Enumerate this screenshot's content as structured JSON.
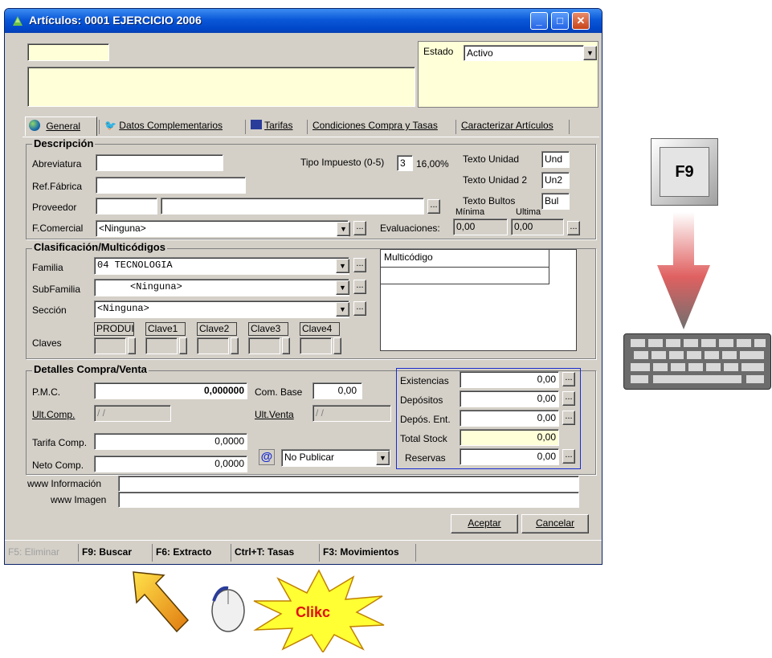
{
  "window": {
    "title": "Artículos: 0001 EJERCICIO 2006",
    "title_icon": "tree-icon",
    "controls": {
      "minimize": "_",
      "maximize": "□",
      "close": "✕"
    }
  },
  "header": {
    "code_value": "",
    "description_value": "",
    "estado_label": "Estado",
    "estado_value": "Activo"
  },
  "tabs": [
    {
      "label": "General",
      "icon": "globe-icon"
    },
    {
      "label": "Datos Complementarios",
      "icon": "bird-icon"
    },
    {
      "label": "Tarifas",
      "icon": "tag-icon"
    },
    {
      "label": "Condiciones Compra y Tasas"
    },
    {
      "label": "Caracterizar Artículos"
    }
  ],
  "descripcion": {
    "title": "Descripción",
    "abreviatura_label": "Abreviatura",
    "ref_fabrica_label": "Ref.Fábrica",
    "proveedor_label": "Proveedor",
    "fcomercial_label": "F.Comercial",
    "fcomercial_value": "<Ninguna>",
    "tipo_impuesto_label": "Tipo Impuesto (0-5)",
    "tipo_impuesto_value": "3",
    "tipo_impuesto_pct": "16,00%",
    "texto_unidad_label": "Texto Unidad",
    "texto_unidad_value": "Und",
    "texto_unidad2_label": "Texto Unidad 2",
    "texto_unidad2_value": "Un2",
    "texto_bultos_label": "Texto Bultos",
    "texto_bultos_value": "Bul",
    "minima_label": "Mínima",
    "ultima_label": "Ultima",
    "evaluaciones_label": "Evaluaciones:",
    "eval_minima": "0,00",
    "eval_ultima": "0,00"
  },
  "clasificacion": {
    "title": "Clasificación/Multicódigos",
    "familia_label": "Familia",
    "familia_value": "04 TECNOLOGIA",
    "subfamilia_label": "SubFamilia",
    "subfamilia_value": "<Ninguna>",
    "seccion_label": "Sección",
    "seccion_value": "<Ninguna>",
    "claves_label": "Claves",
    "claves": [
      "PRODUI",
      "Clave1",
      "Clave2",
      "Clave3",
      "Clave4"
    ],
    "multicodigo_header": "Multicódigo"
  },
  "detalles": {
    "title": "Detalles Compra/Venta",
    "pmc_label": "P.M.C.",
    "pmc_value": "0,000000",
    "com_base_label": "Com. Base",
    "com_base_value": "0,00",
    "ult_comp_label": "Ult.Comp.",
    "ult_comp_value": "/ /",
    "ult_venta_label": "Ult.Venta",
    "ult_venta_value": "/ /",
    "tarifa_comp_label": "Tarifa Comp.",
    "tarifa_comp_value": "0,0000",
    "neto_comp_label": "Neto Comp.",
    "neto_comp_value": "0,0000",
    "publicar_value": "No Publicar",
    "stock": [
      {
        "label": "Existencias",
        "value": "0,00",
        "has_button": true
      },
      {
        "label": "Depósitos",
        "value": "0,00",
        "has_button": true
      },
      {
        "label": "Depós. Ent.",
        "value": "0,00",
        "has_button": true
      },
      {
        "label": "Total Stock",
        "value": "0,00",
        "has_button": false
      },
      {
        "label": "Reservas",
        "value": "0,00",
        "has_button": true
      }
    ],
    "www_info_label": "www Información",
    "www_imagen_label": "www Imagen"
  },
  "buttons": {
    "aceptar": "Aceptar",
    "cancelar": "Cancelar",
    "dots": "...",
    "dropdown": "▼"
  },
  "statusbar": [
    {
      "label": "F5: Eliminar",
      "enabled": false
    },
    {
      "label": "F9: Buscar",
      "enabled": true
    },
    {
      "label": "F6: Extracto",
      "enabled": true
    },
    {
      "label": "Ctrl+T: Tasas",
      "enabled": true
    },
    {
      "label": "F3: Movimientos",
      "enabled": true
    }
  ],
  "annotations": {
    "f9_key": "F9",
    "click_label": "Clikc"
  },
  "colors": {
    "title_blue": "#0a58d8",
    "yellow_field": "#ffffd8",
    "click_star": "#ffff33",
    "click_text": "#e01010"
  }
}
